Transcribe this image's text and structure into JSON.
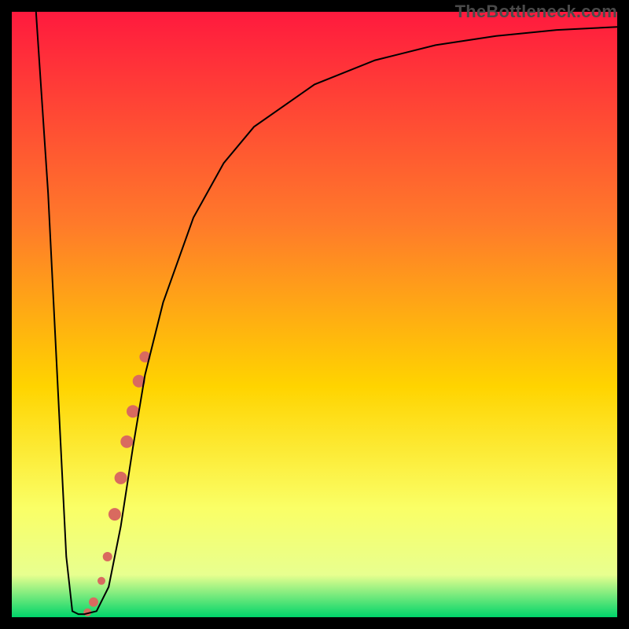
{
  "watermark": "TheBottleneck.com",
  "gradient": {
    "top": "#ff1a3e",
    "mid1": "#ff7a2a",
    "mid2": "#ffd400",
    "mid3": "#faff66",
    "band": "#e8ff8f",
    "bottom": "#00d46a"
  },
  "chart_data": {
    "type": "line",
    "title": "",
    "xlabel": "",
    "ylabel": "",
    "xlim": [
      0,
      100
    ],
    "ylim": [
      0,
      100
    ],
    "series": [
      {
        "name": "curve",
        "x": [
          4,
          6,
          8,
          9,
          10,
          11,
          12,
          14,
          16,
          18,
          20,
          22,
          25,
          30,
          35,
          40,
          50,
          60,
          70,
          80,
          90,
          100
        ],
        "y": [
          100,
          70,
          30,
          10,
          1,
          0.5,
          0.5,
          1,
          5,
          15,
          28,
          40,
          52,
          66,
          75,
          81,
          88,
          92,
          94.5,
          96,
          97,
          97.5
        ]
      }
    ],
    "markers": {
      "name": "highlight-segment",
      "color": "#d96a5f",
      "points": [
        {
          "x": 12.5,
          "y": 0.8,
          "r": 5
        },
        {
          "x": 13.5,
          "y": 2.5,
          "r": 6
        },
        {
          "x": 14.8,
          "y": 6.0,
          "r": 5
        },
        {
          "x": 15.8,
          "y": 10.0,
          "r": 6
        },
        {
          "x": 17.0,
          "y": 17.0,
          "r": 8
        },
        {
          "x": 18.0,
          "y": 23.0,
          "r": 8
        },
        {
          "x": 19.0,
          "y": 29.0,
          "r": 8
        },
        {
          "x": 20.0,
          "y": 34.0,
          "r": 8
        },
        {
          "x": 21.0,
          "y": 39.0,
          "r": 8
        },
        {
          "x": 22.0,
          "y": 43.0,
          "r": 7
        }
      ]
    }
  }
}
